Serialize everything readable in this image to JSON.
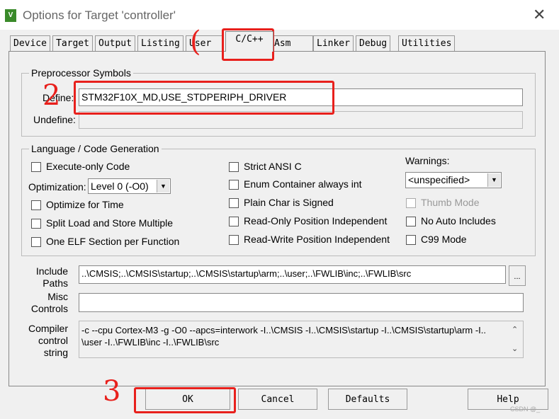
{
  "window": {
    "title": "Options for Target 'controller'"
  },
  "tabs": [
    {
      "label": "Device"
    },
    {
      "label": "Target"
    },
    {
      "label": "Output"
    },
    {
      "label": "Listing"
    },
    {
      "label": "User"
    },
    {
      "label": "C/C++",
      "active": true
    },
    {
      "label": "Asm"
    },
    {
      "label": "Linker"
    },
    {
      "label": "Debug"
    },
    {
      "label": "Utilities"
    }
  ],
  "preprocessor": {
    "title": "Preprocessor Symbols",
    "define_label": "Define:",
    "define_value": "STM32F10X_MD,USE_STDPERIPH_DRIVER",
    "undefine_label": "Undefine:",
    "undefine_value": ""
  },
  "language": {
    "title": "Language / Code Generation",
    "execute_only": "Execute-only Code",
    "optimization_label": "Optimization:",
    "optimization_value": "Level 0 (-O0)",
    "optimize_time": "Optimize for Time",
    "split_load": "Split Load and Store Multiple",
    "one_elf": "One ELF Section per Function",
    "strict_ansi": "Strict ANSI C",
    "enum_container": "Enum Container always int",
    "plain_char": "Plain Char is Signed",
    "ro_pos": "Read-Only Position Independent",
    "rw_pos": "Read-Write Position Independent",
    "warnings_label": "Warnings:",
    "warnings_value": "<unspecified>",
    "thumb_mode": "Thumb Mode",
    "no_auto_includes": "No Auto Includes",
    "c99_mode": "C99 Mode"
  },
  "include": {
    "label1": "Include",
    "label2": "Paths",
    "value": "..\\CMSIS;..\\CMSIS\\startup;..\\CMSIS\\startup\\arm;..\\user;..\\FWLIB\\inc;..\\FWLIB\\src",
    "browse": "..."
  },
  "misc": {
    "label1": "Misc",
    "label2": "Controls",
    "value": ""
  },
  "compiler": {
    "label1": "Compiler",
    "label2": "control",
    "label3": "string",
    "line1": "-c --cpu Cortex-M3 -g -O0 --apcs=interwork -I..\\CMSIS -I..\\CMSIS\\startup -I..\\CMSIS\\startup\\arm -I..",
    "line2": "\\user -I..\\FWLIB\\inc -I..\\FWLIB\\src"
  },
  "buttons": {
    "ok": "OK",
    "cancel": "Cancel",
    "defaults": "Defaults",
    "help": "Help"
  },
  "annotations": {
    "a1": "(",
    "a2": "2",
    "a3": "3",
    "watermark": "CSDN @_"
  },
  "colors": {
    "annotation": "#e8201c"
  }
}
